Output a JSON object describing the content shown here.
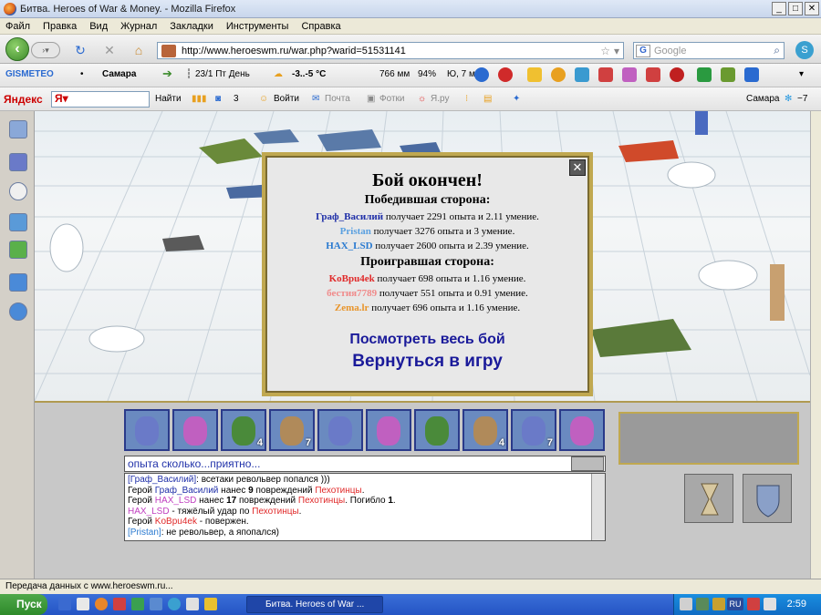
{
  "window": {
    "title": "Битва. Heroes of War & Money. - Mozilla Firefox",
    "btn_min": "_",
    "btn_max": "□",
    "btn_close": "✕"
  },
  "menu": [
    "Файл",
    "Правка",
    "Вид",
    "Журнал",
    "Закладки",
    "Инструменты",
    "Справка"
  ],
  "nav": {
    "url": "http://www.heroeswm.ru/war.php?warid=51531141",
    "search_placeholder": "Google"
  },
  "weather": {
    "brand": "GISMETEO",
    "city": "Самара",
    "date": "23/1 Пт День",
    "temp": "-3..-5 °C",
    "pressure": "766 мм",
    "humidity": "94%",
    "wind": "Ю, 7 м/с"
  },
  "yandex": {
    "logo": "Яндекс",
    "input": "Я",
    "find": "Найти",
    "count": "3",
    "login": "Войти",
    "mail": "Почта",
    "photos": "Фотки",
    "yaru": "Я.ру",
    "city": "Самара",
    "temp": "−7"
  },
  "dialog": {
    "title": "Бой окончен!",
    "win_header": "Победившая сторона:",
    "winners": [
      {
        "name": "Граф_Василий",
        "color": "#1f2fa8",
        "text": " получает 2291 опыта и 2.11 умение."
      },
      {
        "name": "Pristan",
        "color": "#5aa0e0",
        "text": " получает 3276 опыта и 3 умение."
      },
      {
        "name": "HAX_LSD",
        "color": "#2a7ad0",
        "text": " получает 2600 опыта и 2.39 умение."
      }
    ],
    "lose_header": "Проигравшая сторона:",
    "losers": [
      {
        "name": "KoBpu4ek",
        "color": "#e02a2a",
        "text": " получает 698 опыта и 1.16 умение."
      },
      {
        "name": "бестия7789",
        "color": "#f08a8a",
        "text": " получает 551 опыта и 0.91 умение."
      },
      {
        "name": "Zema.lr",
        "color": "#e8942a",
        "text": " получает 696 опыта и 1.16 умение."
      }
    ],
    "link_view": "Посмотреть весь бой",
    "link_back": "Вернуться в игру",
    "close": "✕"
  },
  "portraits": [
    {
      "color": "#6a7ac8",
      "count": ""
    },
    {
      "color": "#c060c0",
      "count": ""
    },
    {
      "color": "#4a8a3a",
      "count": "4"
    },
    {
      "color": "#b08a5a",
      "count": "7"
    },
    {
      "color": "#6a7ac8",
      "count": ""
    },
    {
      "color": "#c060c0",
      "count": ""
    },
    {
      "color": "#4a8a3a",
      "count": ""
    },
    {
      "color": "#b08a5a",
      "count": "4"
    },
    {
      "color": "#6a7ac8",
      "count": "7"
    },
    {
      "color": "#c060c0",
      "count": ""
    }
  ],
  "chat": {
    "input": "опыта сколько...приятно...",
    "rows": [
      [
        {
          "t": "[Граф_Василий]",
          "c": "#1f2fa8"
        },
        {
          "t": ": всетаки револьвер попался )))",
          "c": "#000"
        }
      ],
      [
        {
          "t": "Герой ",
          "c": "#000"
        },
        {
          "t": "Граф_Василий",
          "c": "#1f2fa8"
        },
        {
          "t": " нанес ",
          "c": "#000"
        },
        {
          "t": "9",
          "c": "#000",
          "b": true
        },
        {
          "t": " повреждений ",
          "c": "#000"
        },
        {
          "t": "Пехотинцы",
          "c": "#e02a2a"
        },
        {
          "t": ".",
          "c": "#000"
        }
      ],
      [
        {
          "t": "Герой ",
          "c": "#000"
        },
        {
          "t": "HAX_LSD",
          "c": "#c040c0"
        },
        {
          "t": " нанес ",
          "c": "#000"
        },
        {
          "t": "17",
          "c": "#000",
          "b": true
        },
        {
          "t": " повреждений ",
          "c": "#000"
        },
        {
          "t": "Пехотинцы",
          "c": "#e02a2a"
        },
        {
          "t": ". Погибло ",
          "c": "#000"
        },
        {
          "t": "1",
          "c": "#000",
          "b": true
        },
        {
          "t": ".",
          "c": "#000"
        }
      ],
      [
        {
          "t": "HAX_LSD",
          "c": "#c040c0"
        },
        {
          "t": " - тяжёлый удар по ",
          "c": "#000"
        },
        {
          "t": "Пехотинцы",
          "c": "#e02a2a"
        },
        {
          "t": ".",
          "c": "#000"
        }
      ],
      [
        {
          "t": "Герой ",
          "c": "#000"
        },
        {
          "t": "KoBpu4ek",
          "c": "#e02a2a"
        },
        {
          "t": " - повержен.",
          "c": "#000"
        }
      ],
      [
        {
          "t": "[Pristan]",
          "c": "#2a7ad0"
        },
        {
          "t": ": не револьвер, а япопался)",
          "c": "#000"
        }
      ]
    ]
  },
  "status": "Передача данных с www.heroeswm.ru...",
  "taskbar": {
    "start": "Пуск",
    "task": "Битва. Heroes of War ...",
    "lang": "RU",
    "clock": "2:59"
  }
}
